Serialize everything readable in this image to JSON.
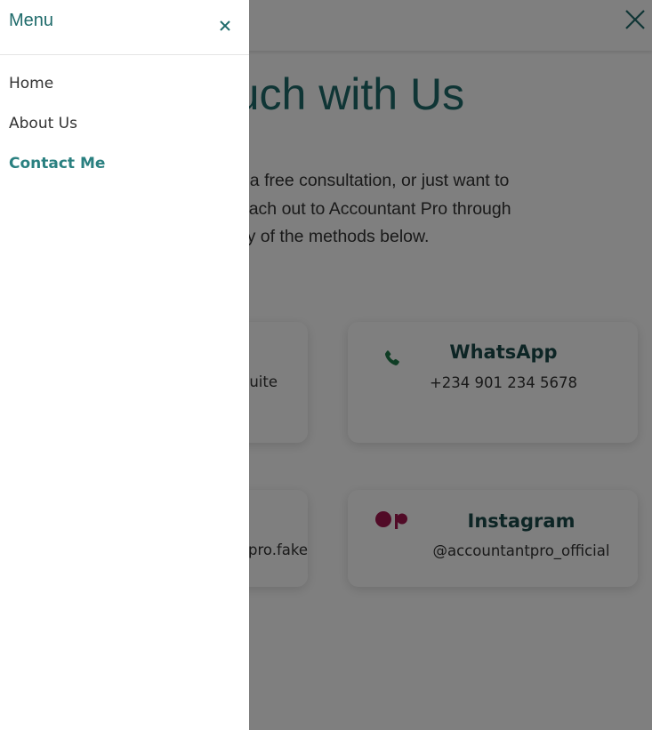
{
  "page": {
    "title": "Touch with Us",
    "intro": "ions, want a free consultation, or just want to to help! Reach out to Accountant Pro through y of the methods below.",
    "intro_lines": [
      "ions, want a free consultation, or just want to",
      "to help! Reach out to Accountant Pro through",
      "y of the methods below."
    ],
    "close_icon": "close-icon"
  },
  "contact_cards": [
    {
      "id": "address",
      "title": "",
      "detail": "Suite",
      "icon": ""
    },
    {
      "id": "whatsapp",
      "title": "WhatsApp",
      "detail": "+234 901 234 5678",
      "icon": "phone-icon",
      "icon_color": "#1f7a4a"
    },
    {
      "id": "email",
      "title": "",
      "detail": "pro.fake",
      "icon": ""
    },
    {
      "id": "instagram",
      "title": "Instagram",
      "detail": "@accountantpro_official",
      "icon": "instagram-icon",
      "icon_color": "#a3174f"
    }
  ],
  "drawer": {
    "title": "Menu",
    "close_icon": "close-icon",
    "items": [
      {
        "label": "Home",
        "active": false
      },
      {
        "label": "About Us",
        "active": false
      },
      {
        "label": "Contact Me",
        "active": true
      }
    ]
  },
  "colors": {
    "accent": "#1f6b6b",
    "active_link": "#2a8080",
    "overlay": "rgba(0,0,0,0.5)"
  }
}
